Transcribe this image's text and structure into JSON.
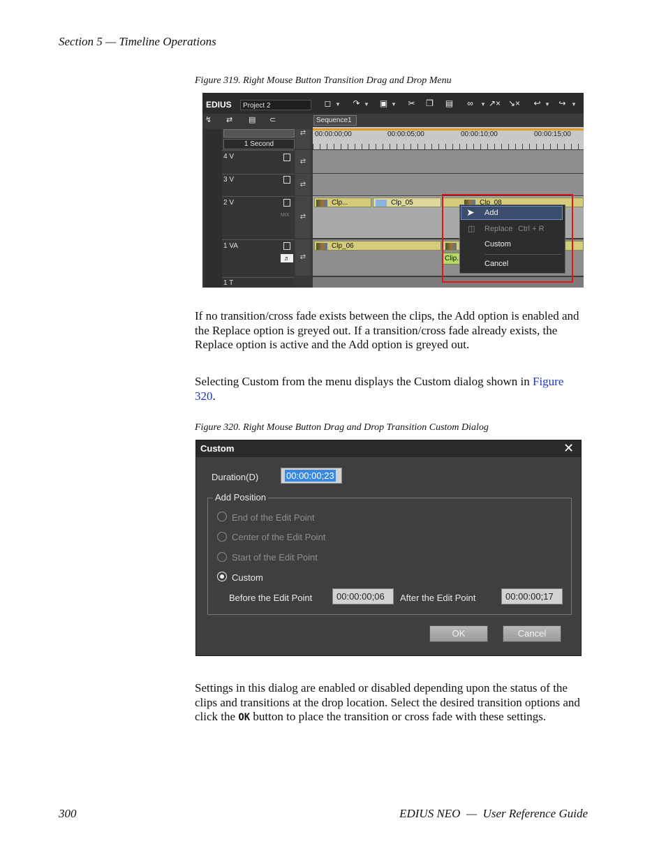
{
  "header": {
    "section": "Section 5 — Timeline Operations"
  },
  "figure319": {
    "caption": "Figure 319.  Right Mouse Button Transition Drag and Drop Menu",
    "app_logo": "EDIUS",
    "project_name": "Project 2",
    "sequence_tab": "Sequence1",
    "scale": "1 Second",
    "timecodes": [
      "00:00:00;00",
      "00:00:05;00",
      "00:00:10;00",
      "00:00:15;00"
    ],
    "tracks": [
      "4 V",
      "3 V",
      "2 V",
      "1 VA",
      "1 T"
    ],
    "clips": [
      "Clp...",
      "Clp_05",
      "Clp_08",
      "Clp_06",
      "Clip..."
    ],
    "track_mix_label": "MIX",
    "context_menu": {
      "add": "Add",
      "replace": "Replace",
      "replace_shortcut": "Ctrl + R",
      "custom": "Custom",
      "cancel": "Cancel"
    }
  },
  "paragraph1": "If no transition/cross fade exists between the clips, the Add option is enabled and the Replace option is greyed out. If a transition/cross fade already exists, the Replace option is active and the Add option is greyed out.",
  "paragraph2": {
    "before": "Selecting Custom from the menu displays the Custom dialog shown in ",
    "link": "Figure 320",
    "after": "."
  },
  "figure320": {
    "caption": "Figure 320.  Right Mouse Button Drag and Drop Transition Custom Dialog",
    "title": "Custom",
    "close_glyph": "✕",
    "duration_label": "Duration(D)",
    "duration_value": "00:00:00;23",
    "group_label": "Add Position",
    "options": [
      "End of the Edit Point",
      "Center of the Edit Point",
      "Start of the Edit Point",
      "Custom"
    ],
    "selected_option": "Custom",
    "before_label": "Before the Edit Point",
    "before_value": "00:00:00;06",
    "after_label": "After the Edit Point",
    "after_value": "00:00:00;17",
    "ok": "OK",
    "cancel": "Cancel"
  },
  "paragraph3": {
    "before": "Settings in this dialog are enabled or disabled depending upon the status of the clips and transitions at the drop location. Select the desired transition options and click the ",
    "ok_word": "OK",
    "after": " button to place the transition or cross fade with these settings."
  },
  "footer": {
    "page_number": "300",
    "guide": "EDIUS NEO  —  User Reference Guide"
  }
}
